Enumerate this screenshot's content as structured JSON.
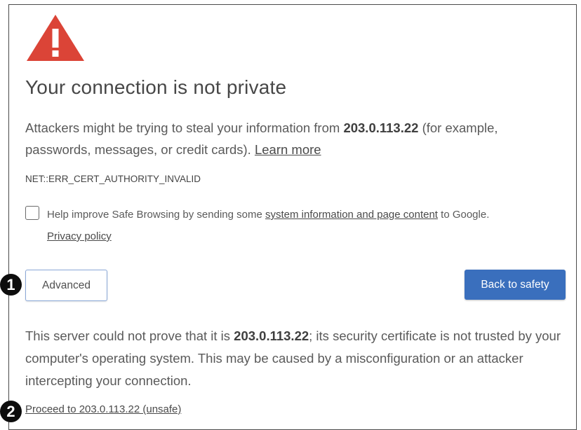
{
  "page": {
    "title": "Your connection is not private",
    "description": {
      "part1": "Attackers might be trying to steal your information from ",
      "host": "203.0.113.22",
      "part2": " (for example, passwords, messages, or credit cards). ",
      "learn_more": "Learn more"
    },
    "error_code": "NET::ERR_CERT_AUTHORITY_INVALID",
    "safe_browsing": {
      "checked": false,
      "part1": "Help improve Safe Browsing by sending some ",
      "link": "system information and page content",
      "part2": " to Google.",
      "privacy_link": "Privacy policy"
    },
    "buttons": {
      "advanced": "Advanced",
      "back": "Back to safety"
    },
    "details": {
      "part1": "This server could not prove that it is ",
      "host": "203.0.113.22",
      "part2": "; its security certificate is not trusted by your computer's operating system. This may be caused by a misconfiguration or an attacker intercepting your connection."
    },
    "proceed_link": "Proceed to 203.0.113.22 (unsafe)"
  },
  "callouts": [
    "1",
    "2"
  ],
  "icons": {
    "warning": "warning-triangle-icon"
  },
  "colors": {
    "warning_red": "#db4437",
    "primary_blue": "#3a6fbd",
    "text": "#5a5a5a"
  }
}
